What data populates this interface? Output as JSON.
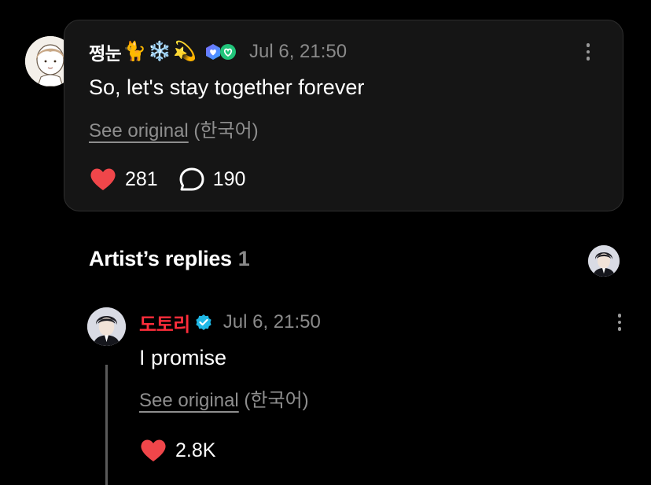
{
  "comment": {
    "author_name": "쩡눈",
    "author_emojis": [
      "🐈",
      "❄️",
      "💫"
    ],
    "badge_icons": [
      "membership-heart-badge",
      "fan-heart-badge"
    ],
    "timestamp": "Jul 6, 21:50",
    "text": "So, let's stay together forever",
    "see_original_label": "See original",
    "source_language": "(한국어)",
    "like_count": "281",
    "reply_count": "190",
    "like_icon": "heart-icon",
    "reply_icon": "speech-bubble-icon"
  },
  "replies_section": {
    "title": "Artist’s replies",
    "count": "1"
  },
  "reply": {
    "author_name": "도토리",
    "verified_icon": "verified-badge-icon",
    "timestamp": "Jul 6, 21:50",
    "text": "I promise",
    "see_original_label": "See original",
    "source_language": "(한국어)",
    "like_count": "2.8K"
  },
  "colors": {
    "background": "#000000",
    "card_background": "#151515",
    "heart": "#f0464a",
    "artist_name": "#ff2d3b",
    "verified": "#1fb8e6",
    "secondary_text": "#8a8a8a"
  }
}
